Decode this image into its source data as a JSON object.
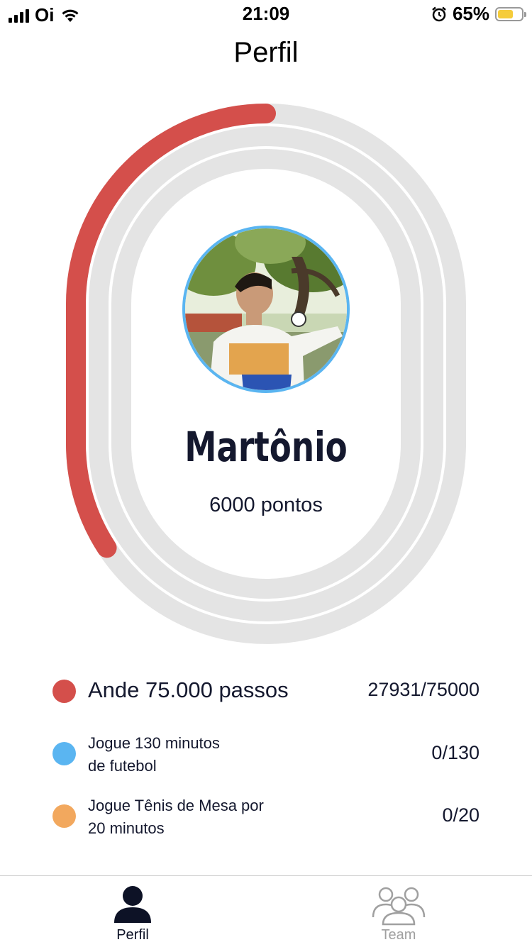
{
  "status_bar": {
    "carrier": "Oi",
    "time": "21:09",
    "battery": "65%",
    "battery_level": 0.65,
    "icons": [
      "signal-icon",
      "wifi-icon",
      "alarm-icon",
      "battery-icon"
    ]
  },
  "header": {
    "title": "Perfil"
  },
  "profile": {
    "name": "Martônio",
    "points": "6000 pontos",
    "ring_progress": 0.372
  },
  "challenges": [
    {
      "label": "Ande 75.000 passos",
      "progress": "27931/75000",
      "color": "#d44f4b"
    },
    {
      "label_lines": [
        "Jogue 130 minutos",
        "de futebol"
      ],
      "progress": "0/130",
      "color": "#5ab5f1"
    },
    {
      "label_lines": [
        "Jogue Tênis de Mesa por",
        "20 minutos"
      ],
      "progress": "0/20",
      "color": "#f2a85e"
    }
  ],
  "tabs": [
    {
      "label": "Perfil",
      "icon": "person-icon",
      "active": true
    },
    {
      "label": "Team",
      "icon": "team-icon",
      "active": false
    }
  ],
  "colors": {
    "accent_red": "#d44f4b",
    "track_gray": "#e4e4e4",
    "text_dark": "#14182e",
    "inactive": "#a0a0a0"
  }
}
